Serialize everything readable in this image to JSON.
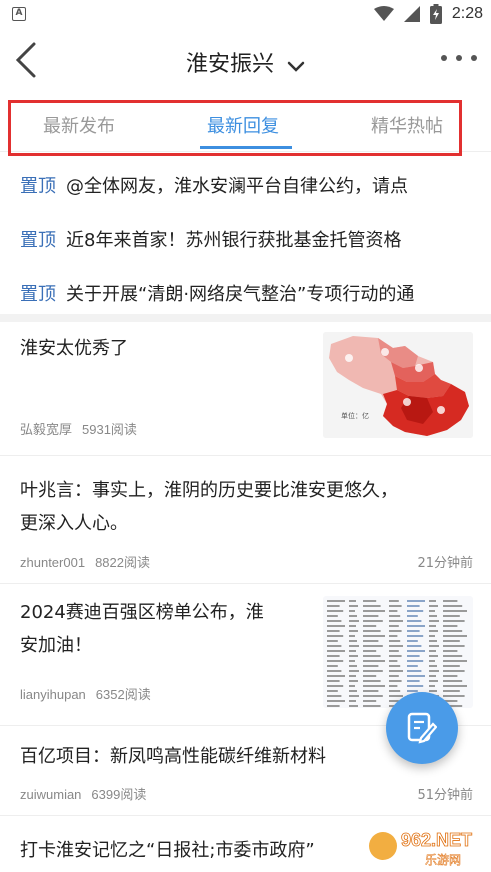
{
  "status_bar": {
    "time": "2:28",
    "left_icon": "A"
  },
  "header": {
    "title": "淮安振兴"
  },
  "tabs": [
    {
      "label": "最新发布",
      "active": false
    },
    {
      "label": "最新回复",
      "active": true
    },
    {
      "label": "精华热帖",
      "active": false
    }
  ],
  "pinned": [
    {
      "tag": "置顶",
      "text": "@全体网友，淮水安澜平台自律公约，请点"
    },
    {
      "tag": "置顶",
      "text": "近8年来首家！苏州银行获批基金托管资格"
    },
    {
      "tag": "置顶",
      "text": "关于开展“清朗·网络戾气整治”专项行动的通"
    }
  ],
  "feed": [
    {
      "title_lines": [
        "淮安太优秀了"
      ],
      "author": "弘毅宽厚",
      "reads": "5931阅读",
      "time": "",
      "thumb": "map-image",
      "map_label": "单位：亿"
    },
    {
      "title_lines": [
        "叶兆言：事实上，淮阴的历史要比淮安更悠久，",
        "更深入人心。"
      ],
      "author": "zhunter001",
      "reads": "8822阅读",
      "time": "21分钟前"
    },
    {
      "title_lines": [
        "2024赛迪百强区榜单公布，淮",
        "安加油！"
      ],
      "author": "lianyihupan",
      "reads": "6352阅读",
      "time": "",
      "thumb": "table-image"
    },
    {
      "title_lines": [
        "百亿项目：新凤鸣高性能碳纤维新材料"
      ],
      "author": "zuiwumian",
      "reads": "6399阅读",
      "time": "51分钟前"
    },
    {
      "title_lines": [
        "打卡淮安记忆之“日报社;市委市政府”"
      ],
      "author": "",
      "reads": "",
      "time": ""
    }
  ],
  "watermark": {
    "brand": "962.NET",
    "sub": "乐游网"
  },
  "colors": {
    "accent": "#3d8fe0",
    "pin_tag": "#3a6fb7",
    "highlight_frame": "#e23030",
    "fab": "#4a9be8"
  }
}
